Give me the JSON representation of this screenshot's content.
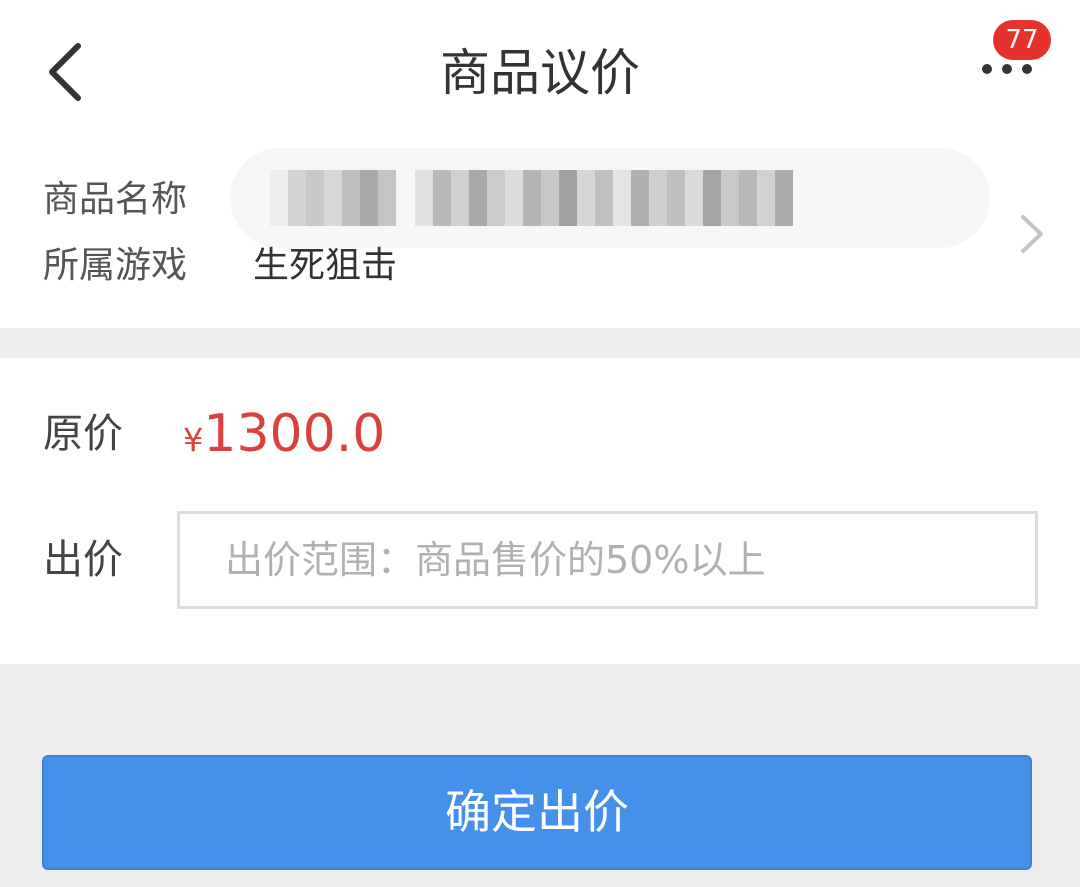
{
  "header": {
    "title": "商品议价",
    "back_icon": "chevron-left-icon",
    "more_icon": "more-dots-icon",
    "notification_count": "77",
    "badge_color": "#e5322d"
  },
  "product": {
    "name_label": "商品名称",
    "game_label": "所属游戏",
    "game_value": "生死狙击",
    "name_value_redacted": true,
    "detail_icon": "chevron-right-icon"
  },
  "price": {
    "original_label": "原价",
    "currency_symbol": "¥",
    "original_amount": "1300.0",
    "price_color": "#d94040"
  },
  "bid": {
    "label": "出价",
    "placeholder": "出价范围：商品售价的50%以上",
    "value": ""
  },
  "confirm": {
    "label": "确定出价",
    "color": "#4590e8"
  }
}
